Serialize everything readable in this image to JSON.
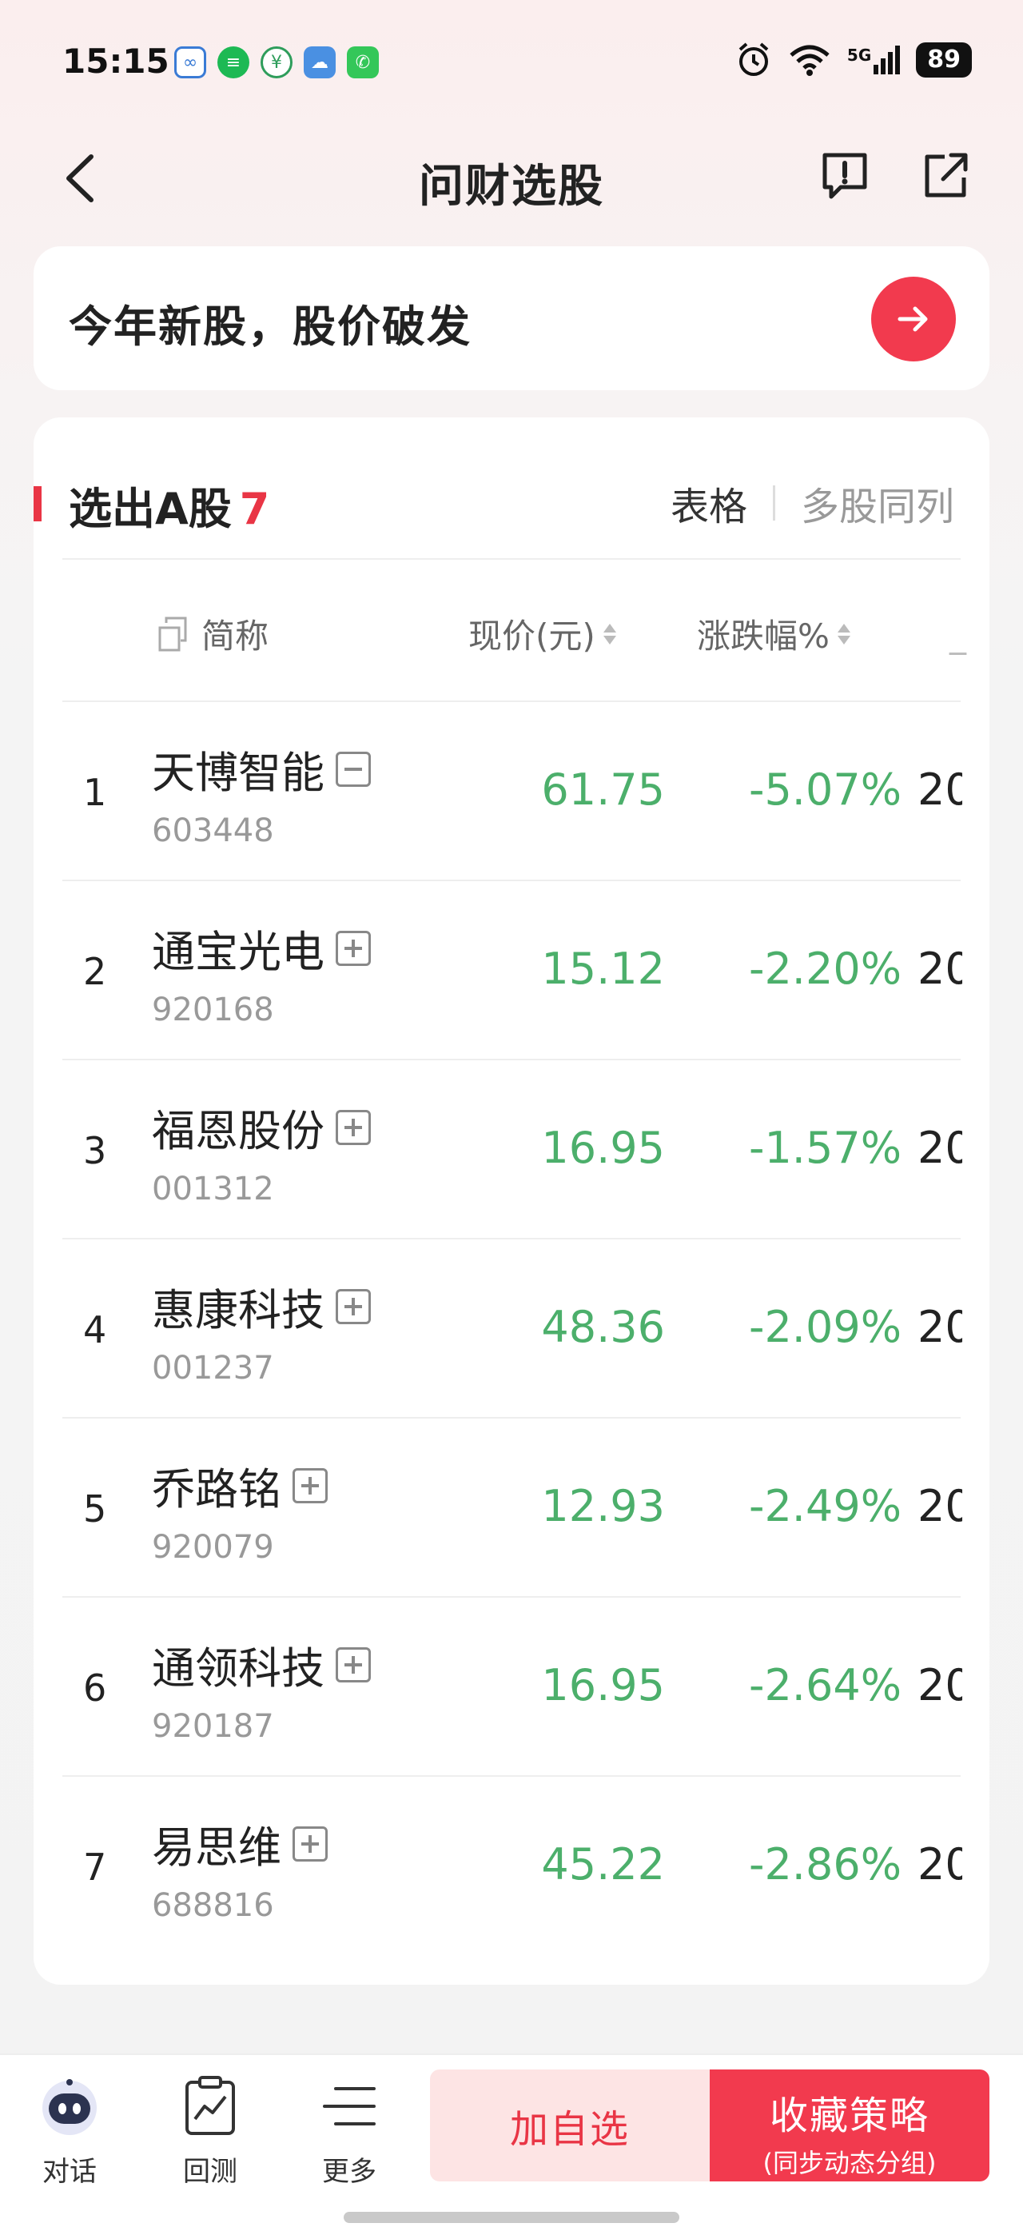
{
  "status_bar": {
    "time": "15:15",
    "network": "5G",
    "battery": "89",
    "app_icons": [
      "linked-app-icon",
      "message-app-icon",
      "eco-app-icon",
      "weather-app-icon",
      "phone-app-icon"
    ]
  },
  "header": {
    "title": "问财选股"
  },
  "query": {
    "text": "今年新股，股价破发"
  },
  "results": {
    "title_prefix": "选出A股",
    "count": "7",
    "view_table": "表格",
    "view_multi": "多股同列",
    "columns": {
      "name": "简称",
      "price": "现价(元)",
      "change": "涨跌幅%"
    },
    "rows": [
      {
        "index": "1",
        "name": "天博智能",
        "code": "603448",
        "price": "61.75",
        "change": "-5.07%",
        "extra": "20",
        "added": true
      },
      {
        "index": "2",
        "name": "通宝光电",
        "code": "920168",
        "price": "15.12",
        "change": "-2.20%",
        "extra": "20",
        "added": false
      },
      {
        "index": "3",
        "name": "福恩股份",
        "code": "001312",
        "price": "16.95",
        "change": "-1.57%",
        "extra": "20",
        "added": false
      },
      {
        "index": "4",
        "name": "惠康科技",
        "code": "001237",
        "price": "48.36",
        "change": "-2.09%",
        "extra": "20",
        "added": false
      },
      {
        "index": "5",
        "name": "乔路铭",
        "code": "920079",
        "price": "12.93",
        "change": "-2.49%",
        "extra": "20",
        "added": false
      },
      {
        "index": "6",
        "name": "通领科技",
        "code": "920187",
        "price": "16.95",
        "change": "-2.64%",
        "extra": "20",
        "added": false
      },
      {
        "index": "7",
        "name": "易思维",
        "code": "688816",
        "price": "45.22",
        "change": "-2.86%",
        "extra": "20",
        "added": false
      }
    ]
  },
  "bottom_nav": {
    "chat": "对话",
    "backtest": "回测",
    "more": "更多",
    "add_watchlist": "加自选",
    "save_strategy": "收藏策略",
    "save_strategy_sub": "(同步动态分组)"
  },
  "colors": {
    "accent_red": "#f23a4e",
    "down_green": "#4caf6b"
  }
}
